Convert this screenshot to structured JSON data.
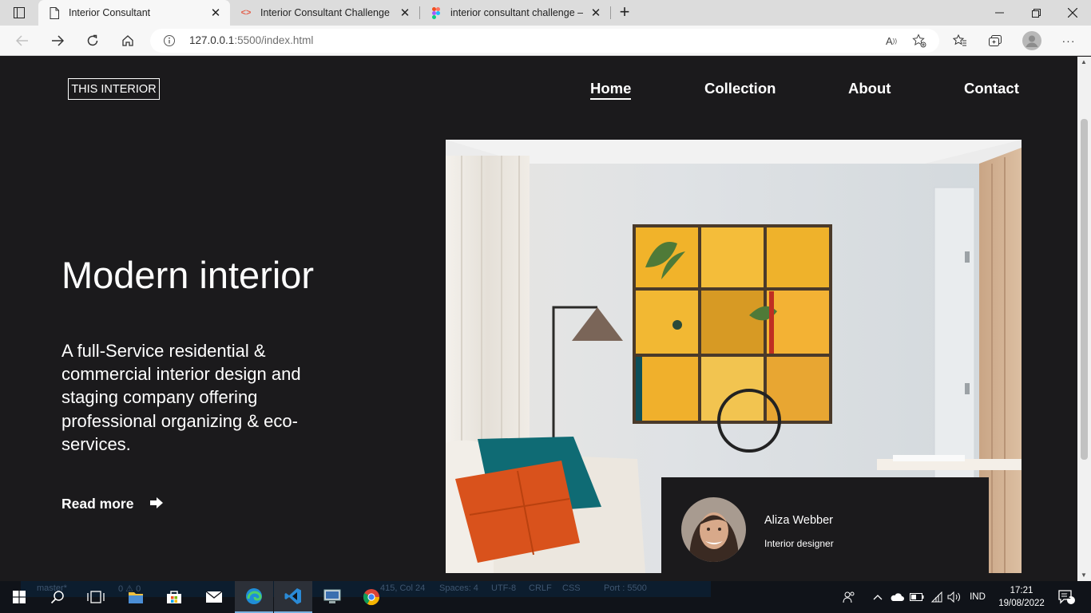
{
  "browser": {
    "tabs": [
      {
        "title": "Interior Consultant",
        "active": true,
        "favicon": "page-icon"
      },
      {
        "title": "Interior Consultant Challenge | d",
        "active": false,
        "favicon": "code-icon"
      },
      {
        "title": "interior consultant challenge – Fi",
        "active": false,
        "favicon": "figma-icon"
      }
    ],
    "new_tab": "+",
    "address": {
      "host": "127.0.0.1",
      "path": ":5500/index.html"
    }
  },
  "site": {
    "logo": "THIS INTERIOR",
    "nav": [
      "Home",
      "Collection",
      "About",
      "Contact"
    ],
    "active_nav": "Home",
    "hero": {
      "title": "Modern interior",
      "description": "A full-Service residential & commercial interior design and staging company offering professional organizing & eco-services.",
      "cta": "Read more"
    },
    "designer": {
      "name": "Aliza Webber",
      "role": "Interior designer"
    }
  },
  "taskbar": {
    "vscode_status": {
      "branch": "master*",
      "problems": "0 ⚠ 0",
      "position": "415, Col 24",
      "spaces": "Spaces: 4",
      "encoding": "UTF-8",
      "eol": "CRLF",
      "language": "CSS",
      "port": "Port : 5500"
    },
    "language": "IND",
    "time": "17:21",
    "date": "19/08/2022",
    "notifications": "1"
  },
  "colors": {
    "page_bg": "#1b1a1c",
    "text": "#ffffff",
    "taskbar": "#101319",
    "wall": "#dfe3e6",
    "art_yellow": "#f3b52a",
    "pillow_orange": "#d9521c",
    "pillow_teal": "#0f6b74"
  }
}
